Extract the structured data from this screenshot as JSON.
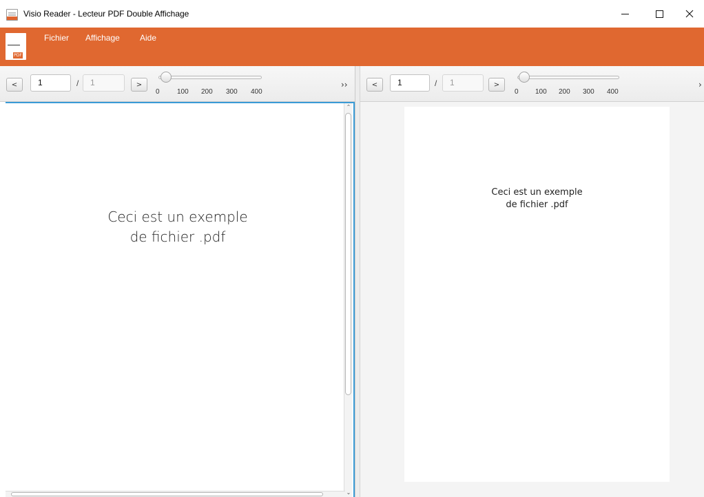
{
  "window": {
    "title": "Visio Reader - Lecteur PDF Double Affichage",
    "icon": "pdf-app-icon"
  },
  "logo": {
    "tag": "PDF"
  },
  "menu": {
    "items": [
      "Fichier",
      "Affichage",
      "Aide"
    ],
    "background": "#e06830"
  },
  "left_view": {
    "prev_label": "<",
    "next_label": ">",
    "current_page": "1",
    "separator": "/",
    "total_pages": "1",
    "zoom_ticks": [
      "0",
      "100",
      "200",
      "300",
      "400"
    ],
    "zoom_value": 0,
    "overflow_label": "››",
    "document_lines": [
      "Ceci est un exemple",
      "de fichier .pdf"
    ],
    "focus_color": "#3a9bd6"
  },
  "right_view": {
    "prev_label": "<",
    "next_label": ">",
    "current_page": "1",
    "separator": "/",
    "total_pages": "1",
    "zoom_ticks": [
      "0",
      "100",
      "200",
      "300",
      "400"
    ],
    "zoom_value": 0,
    "overflow_label": "›",
    "document_lines": [
      "Ceci est un exemple",
      "de fichier .pdf"
    ]
  }
}
